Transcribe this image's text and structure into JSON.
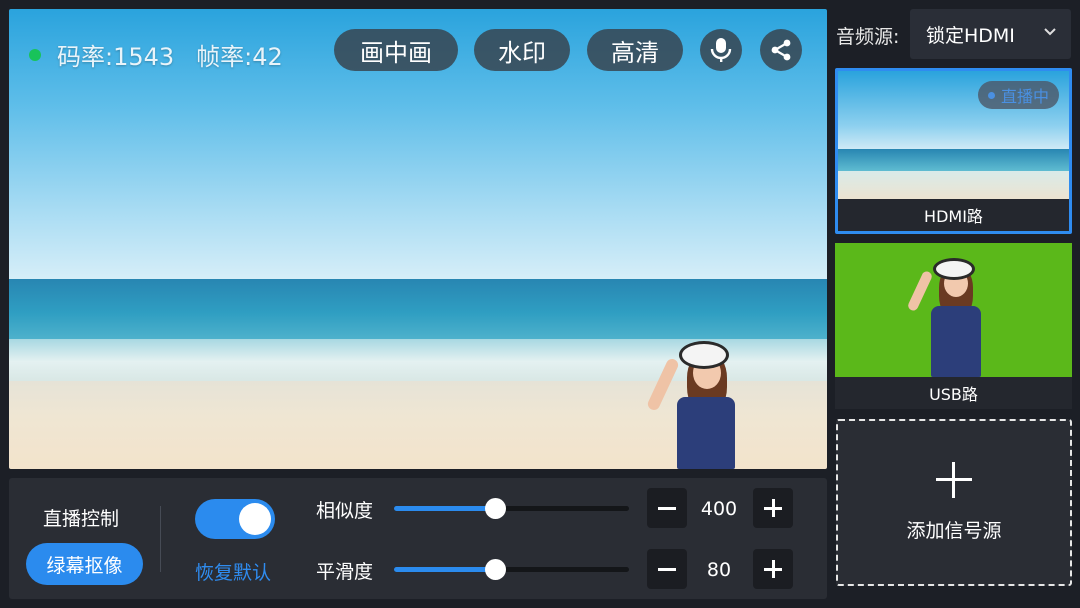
{
  "stats": {
    "bitrate": "码率:1543",
    "framerate": "帧率:42"
  },
  "preview_buttons": {
    "pip": "画中画",
    "watermark": "水印",
    "hd": "高清"
  },
  "audio": {
    "label": "音频源:",
    "selected": "锁定HDMI"
  },
  "sources": [
    {
      "label": "HDMI路",
      "badge": "直播中"
    },
    {
      "label": "USB路"
    }
  ],
  "add_source": "添加信号源",
  "controls": {
    "live_control": "直播控制",
    "chroma_key": "绿幕抠像",
    "reset": "恢复默认",
    "similarity": {
      "label": "相似度",
      "value": "400",
      "level": 0.43
    },
    "smoothness": {
      "label": "平滑度",
      "value": "80",
      "level": 0.43
    }
  },
  "colors": {
    "accent": "#2b8bee",
    "live_dot": "#18c35a",
    "green_screen": "#5bb81a"
  }
}
